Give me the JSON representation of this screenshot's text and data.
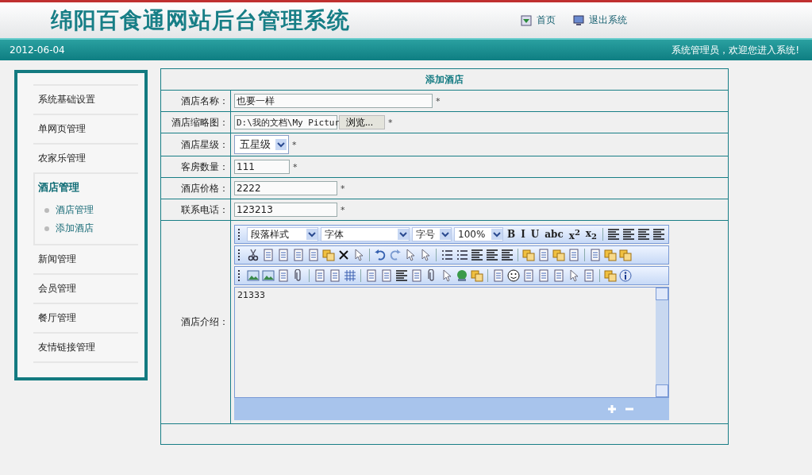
{
  "header": {
    "title": "绵阳百食通网站后台管理系统",
    "links": [
      "首页",
      "退出系统"
    ]
  },
  "status_bar": {
    "date": "2012-06-04",
    "welcome": "系统管理员，欢迎您进入系统!"
  },
  "sidebar": {
    "items": [
      {
        "label": "系统基础设置",
        "expanded": false
      },
      {
        "label": "单网页管理",
        "expanded": false
      },
      {
        "label": "农家乐管理",
        "expanded": false
      },
      {
        "label": "酒店管理",
        "expanded": true,
        "children": [
          {
            "label": "酒店管理"
          },
          {
            "label": "添加酒店"
          }
        ]
      },
      {
        "label": "新闻管理",
        "expanded": false
      },
      {
        "label": "会员管理",
        "expanded": false
      },
      {
        "label": "餐厅管理",
        "expanded": false
      },
      {
        "label": "友情链接管理",
        "expanded": false
      }
    ]
  },
  "form": {
    "title": "添加酒店",
    "rows": [
      {
        "kind": "text",
        "label": "酒店名称：",
        "value": "也要一样",
        "required_mark": "*"
      },
      {
        "kind": "file",
        "label": "酒店缩略图：",
        "value": "D:\\我的文档\\My Pictur",
        "button": "浏览...",
        "required_mark": "*"
      },
      {
        "kind": "select",
        "label": "酒店星级：",
        "value": "五星级",
        "required_mark": "*"
      },
      {
        "kind": "text",
        "label": "客房数量：",
        "value": "111",
        "required_mark": "*"
      },
      {
        "kind": "text",
        "label": "酒店价格：",
        "value": "2222",
        "required_mark": "*"
      },
      {
        "kind": "text",
        "label": "联系电话：",
        "value": "123213",
        "required_mark": "*"
      },
      {
        "kind": "editor",
        "label": "酒店介绍：",
        "value": "21333",
        "dropdowns": [
          "段落样式",
          "字体",
          "字号",
          "100%"
        ],
        "format_buttons": [
          "B",
          "I",
          "U",
          "abc",
          "x$^{2}$",
          "x$_{2}$"
        ]
      }
    ]
  }
}
